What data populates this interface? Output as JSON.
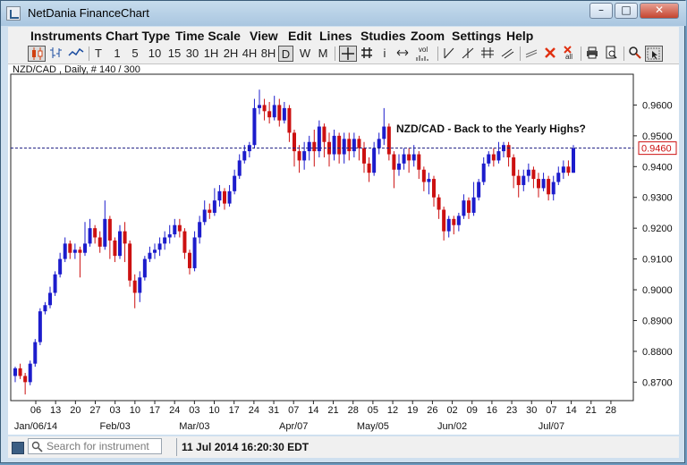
{
  "window": {
    "title": "NetDania FinanceChart",
    "controls": [
      {
        "name": "minimize-button",
        "glyph": "–"
      },
      {
        "name": "maximize-button",
        "glyph": "□"
      },
      {
        "name": "close-button",
        "glyph": "✕"
      }
    ]
  },
  "menubar": {
    "items": [
      "Instruments",
      "Chart Type",
      "Time Scale",
      "View",
      "Edit",
      "Lines",
      "Studies",
      "Zoom",
      "Settings",
      "Help"
    ]
  },
  "toolbar": {
    "intervals": [
      "T",
      "1",
      "5",
      "10",
      "15",
      "30",
      "1H",
      "2H",
      "4H",
      "8H",
      "D",
      "W",
      "M"
    ],
    "selected_interval": "D",
    "info_glyph": "i",
    "volume_label": "vol",
    "clear_all_label": "all"
  },
  "chart_data": {
    "type": "candlestick",
    "instrument_label": "NZD/CAD , Daily, # 140 / 300",
    "annotation": "NZD/CAD - Back to the Yearly Highs?",
    "current_price": 0.946,
    "current_price_label": "0.9460",
    "y_ticks": [
      "0.9600",
      "0.9500",
      "0.9400",
      "0.9300",
      "0.9200",
      "0.9100",
      "0.9000",
      "0.8900",
      "0.8800",
      "0.8700"
    ],
    "x_day_labels": [
      "06",
      "13",
      "20",
      "27",
      "03",
      "10",
      "17",
      "24",
      "03",
      "10",
      "17",
      "24",
      "31",
      "07",
      "14",
      "21",
      "28",
      "05",
      "12",
      "19",
      "26",
      "02",
      "09",
      "16",
      "23",
      "30",
      "07",
      "14",
      "21",
      "28"
    ],
    "x_month_labels": [
      "Jan/06/14",
      "Feb/03",
      "Mar/03",
      "Apr/07",
      "May/05",
      "Jun/02",
      "Jul/07"
    ],
    "ylim": [
      0.864,
      0.97
    ],
    "grid": false,
    "colors": {
      "up": "#1c1ccc",
      "down": "#cc1111",
      "price_line": "#1a1a80"
    },
    "candles": [
      [
        0.872,
        0.8745,
        0.87,
        0.875
      ],
      [
        0.8745,
        0.872,
        0.871,
        0.876
      ],
      [
        0.872,
        0.87,
        0.866,
        0.873
      ],
      [
        0.87,
        0.876,
        0.869,
        0.877
      ],
      [
        0.876,
        0.883,
        0.875,
        0.884
      ],
      [
        0.883,
        0.893,
        0.882,
        0.894
      ],
      [
        0.893,
        0.895,
        0.892,
        0.896
      ],
      [
        0.895,
        0.899,
        0.894,
        0.901
      ],
      [
        0.899,
        0.905,
        0.898,
        0.906
      ],
      [
        0.905,
        0.91,
        0.904,
        0.912
      ],
      [
        0.91,
        0.915,
        0.909,
        0.917
      ],
      [
        0.915,
        0.912,
        0.91,
        0.916
      ],
      [
        0.912,
        0.913,
        0.91,
        0.915
      ],
      [
        0.913,
        0.912,
        0.904,
        0.914
      ],
      [
        0.912,
        0.915,
        0.911,
        0.922
      ],
      [
        0.915,
        0.92,
        0.914,
        0.923
      ],
      [
        0.92,
        0.917,
        0.915,
        0.921
      ],
      [
        0.917,
        0.914,
        0.912,
        0.919
      ],
      [
        0.914,
        0.923,
        0.913,
        0.929
      ],
      [
        0.923,
        0.916,
        0.91,
        0.924
      ],
      [
        0.916,
        0.911,
        0.909,
        0.917
      ],
      [
        0.911,
        0.919,
        0.91,
        0.921
      ],
      [
        0.919,
        0.915,
        0.909,
        0.922
      ],
      [
        0.915,
        0.903,
        0.901,
        0.916
      ],
      [
        0.903,
        0.899,
        0.894,
        0.905
      ],
      [
        0.899,
        0.904,
        0.896,
        0.906
      ],
      [
        0.904,
        0.91,
        0.903,
        0.911
      ],
      [
        0.91,
        0.912,
        0.909,
        0.914
      ],
      [
        0.912,
        0.913,
        0.91,
        0.915
      ],
      [
        0.913,
        0.915,
        0.911,
        0.917
      ],
      [
        0.915,
        0.917,
        0.913,
        0.919
      ],
      [
        0.917,
        0.918,
        0.915,
        0.921
      ],
      [
        0.918,
        0.921,
        0.917,
        0.923
      ],
      [
        0.921,
        0.919,
        0.917,
        0.923
      ],
      [
        0.919,
        0.912,
        0.91,
        0.92
      ],
      [
        0.912,
        0.907,
        0.905,
        0.913
      ],
      [
        0.907,
        0.917,
        0.906,
        0.919
      ],
      [
        0.917,
        0.922,
        0.915,
        0.924
      ],
      [
        0.922,
        0.926,
        0.921,
        0.929
      ],
      [
        0.926,
        0.925,
        0.923,
        0.928
      ],
      [
        0.925,
        0.929,
        0.924,
        0.933
      ],
      [
        0.929,
        0.932,
        0.927,
        0.934
      ],
      [
        0.932,
        0.928,
        0.926,
        0.933
      ],
      [
        0.928,
        0.932,
        0.927,
        0.934
      ],
      [
        0.932,
        0.937,
        0.931,
        0.939
      ],
      [
        0.937,
        0.942,
        0.936,
        0.944
      ],
      [
        0.942,
        0.945,
        0.941,
        0.947
      ],
      [
        0.945,
        0.947,
        0.943,
        0.948
      ],
      [
        0.947,
        0.959,
        0.946,
        0.962
      ],
      [
        0.959,
        0.96,
        0.957,
        0.965
      ],
      [
        0.96,
        0.958,
        0.955,
        0.962
      ],
      [
        0.958,
        0.956,
        0.954,
        0.961
      ],
      [
        0.956,
        0.96,
        0.955,
        0.963
      ],
      [
        0.96,
        0.955,
        0.953,
        0.962
      ],
      [
        0.955,
        0.959,
        0.954,
        0.961
      ],
      [
        0.959,
        0.951,
        0.948,
        0.96
      ],
      [
        0.951,
        0.945,
        0.94,
        0.952
      ],
      [
        0.945,
        0.942,
        0.938,
        0.947
      ],
      [
        0.942,
        0.945,
        0.939,
        0.948
      ],
      [
        0.945,
        0.948,
        0.942,
        0.95
      ],
      [
        0.948,
        0.945,
        0.94,
        0.952
      ],
      [
        0.945,
        0.953,
        0.943,
        0.955
      ],
      [
        0.953,
        0.948,
        0.943,
        0.954
      ],
      [
        0.948,
        0.944,
        0.94,
        0.951
      ],
      [
        0.944,
        0.95,
        0.942,
        0.952
      ],
      [
        0.95,
        0.944,
        0.941,
        0.951
      ],
      [
        0.944,
        0.949,
        0.941,
        0.951
      ],
      [
        0.949,
        0.945,
        0.942,
        0.951
      ],
      [
        0.945,
        0.949,
        0.943,
        0.951
      ],
      [
        0.949,
        0.946,
        0.942,
        0.95
      ],
      [
        0.946,
        0.941,
        0.938,
        0.948
      ],
      [
        0.941,
        0.938,
        0.935,
        0.943
      ],
      [
        0.938,
        0.946,
        0.937,
        0.948
      ],
      [
        0.946,
        0.949,
        0.944,
        0.951
      ],
      [
        0.949,
        0.953,
        0.947,
        0.959
      ],
      [
        0.953,
        0.944,
        0.942,
        0.954
      ],
      [
        0.944,
        0.939,
        0.933,
        0.945
      ],
      [
        0.939,
        0.941,
        0.937,
        0.944
      ],
      [
        0.941,
        0.944,
        0.939,
        0.946
      ],
      [
        0.944,
        0.942,
        0.938,
        0.946
      ],
      [
        0.942,
        0.944,
        0.94,
        0.947
      ],
      [
        0.944,
        0.939,
        0.936,
        0.945
      ],
      [
        0.939,
        0.935,
        0.932,
        0.94
      ],
      [
        0.935,
        0.936,
        0.931,
        0.938
      ],
      [
        0.936,
        0.93,
        0.927,
        0.937
      ],
      [
        0.93,
        0.926,
        0.923,
        0.931
      ],
      [
        0.926,
        0.919,
        0.916,
        0.927
      ],
      [
        0.919,
        0.923,
        0.917,
        0.924
      ],
      [
        0.923,
        0.921,
        0.918,
        0.924
      ],
      [
        0.921,
        0.924,
        0.919,
        0.925
      ],
      [
        0.924,
        0.929,
        0.923,
        0.931
      ],
      [
        0.929,
        0.925,
        0.923,
        0.93
      ],
      [
        0.925,
        0.93,
        0.924,
        0.935
      ],
      [
        0.93,
        0.935,
        0.929,
        0.936
      ],
      [
        0.935,
        0.941,
        0.934,
        0.943
      ],
      [
        0.941,
        0.944,
        0.94,
        0.945
      ],
      [
        0.944,
        0.942,
        0.94,
        0.946
      ],
      [
        0.942,
        0.945,
        0.941,
        0.948
      ],
      [
        0.945,
        0.947,
        0.943,
        0.948
      ],
      [
        0.947,
        0.943,
        0.94,
        0.948
      ],
      [
        0.943,
        0.937,
        0.933,
        0.944
      ],
      [
        0.937,
        0.934,
        0.93,
        0.939
      ],
      [
        0.934,
        0.937,
        0.932,
        0.939
      ],
      [
        0.937,
        0.939,
        0.935,
        0.941
      ],
      [
        0.939,
        0.936,
        0.933,
        0.94
      ],
      [
        0.936,
        0.933,
        0.93,
        0.938
      ],
      [
        0.933,
        0.936,
        0.932,
        0.938
      ],
      [
        0.936,
        0.931,
        0.929,
        0.937
      ],
      [
        0.931,
        0.935,
        0.929,
        0.937
      ],
      [
        0.935,
        0.938,
        0.934,
        0.94
      ],
      [
        0.938,
        0.94,
        0.936,
        0.942
      ],
      [
        0.94,
        0.938,
        0.937,
        0.942
      ],
      [
        0.938,
        0.946,
        0.938,
        0.947
      ]
    ]
  },
  "statusbar": {
    "search_placeholder": "Search for instrument",
    "timestamp": "11 Jul 2014 16:20:30 EDT"
  }
}
